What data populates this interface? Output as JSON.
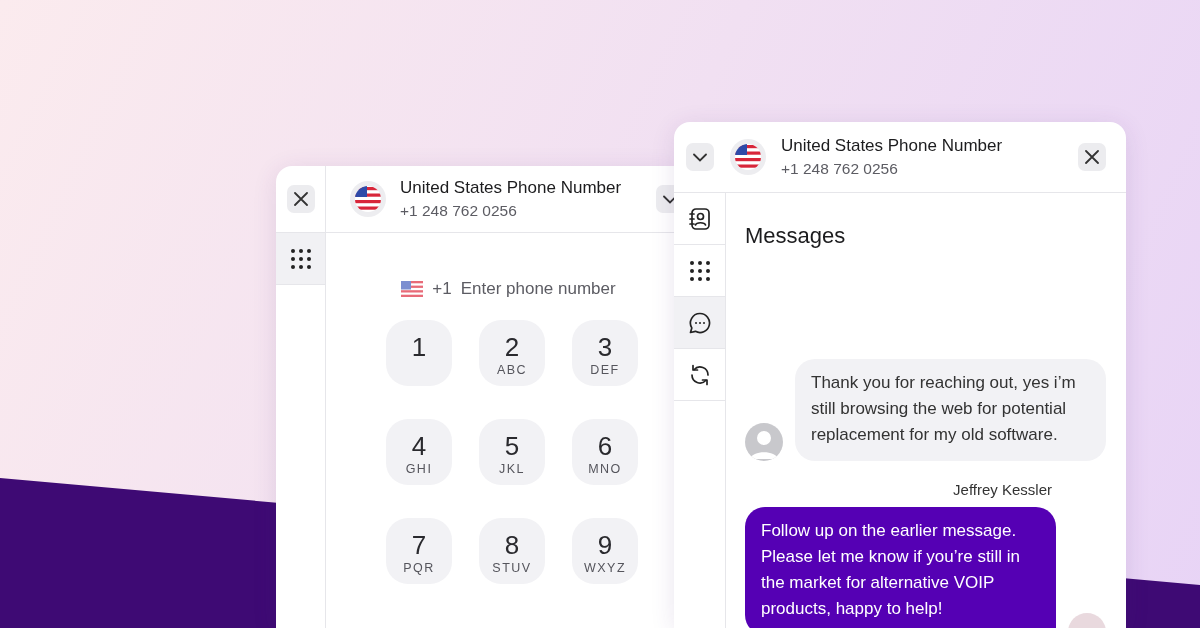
{
  "dialer_window": {
    "header": {
      "title": "United States Phone Number",
      "number": "+1 248 762 0256"
    },
    "sidebar": [
      {
        "kind": "keypad",
        "selected": true
      }
    ],
    "phone_input": {
      "prefix": "+1",
      "placeholder": "Enter phone number"
    },
    "keys": [
      {
        "digit": "1"
      },
      {
        "digit": "2",
        "letters": "ABC"
      },
      {
        "digit": "3",
        "letters": "DEF"
      },
      {
        "digit": "4",
        "letters": "GHI"
      },
      {
        "digit": "5",
        "letters": "JKL"
      },
      {
        "digit": "6",
        "letters": "MNO"
      },
      {
        "digit": "7",
        "letters": "PQR"
      },
      {
        "digit": "8",
        "letters": "STUV"
      },
      {
        "digit": "9",
        "letters": "WXYZ"
      }
    ]
  },
  "messages_window": {
    "header": {
      "title": "United States Phone Number",
      "number": "+1 248 762 0256"
    },
    "sidebar": [
      {
        "kind": "contacts",
        "selected": false
      },
      {
        "kind": "keypad",
        "selected": false
      },
      {
        "kind": "messages",
        "selected": true
      },
      {
        "kind": "sync",
        "selected": false
      }
    ],
    "title": "Messages",
    "messages": [
      {
        "kind": "incoming",
        "text": "Thank you for reaching out, yes i’m still browsing the web for potential replacement for my old software."
      },
      {
        "kind": "outgoing",
        "sender": "Jeffrey Kessler",
        "text": "Follow up on the earlier message. Please let me know if you’re still in the market for alternative VOIP products, happy to help!"
      }
    ]
  }
}
